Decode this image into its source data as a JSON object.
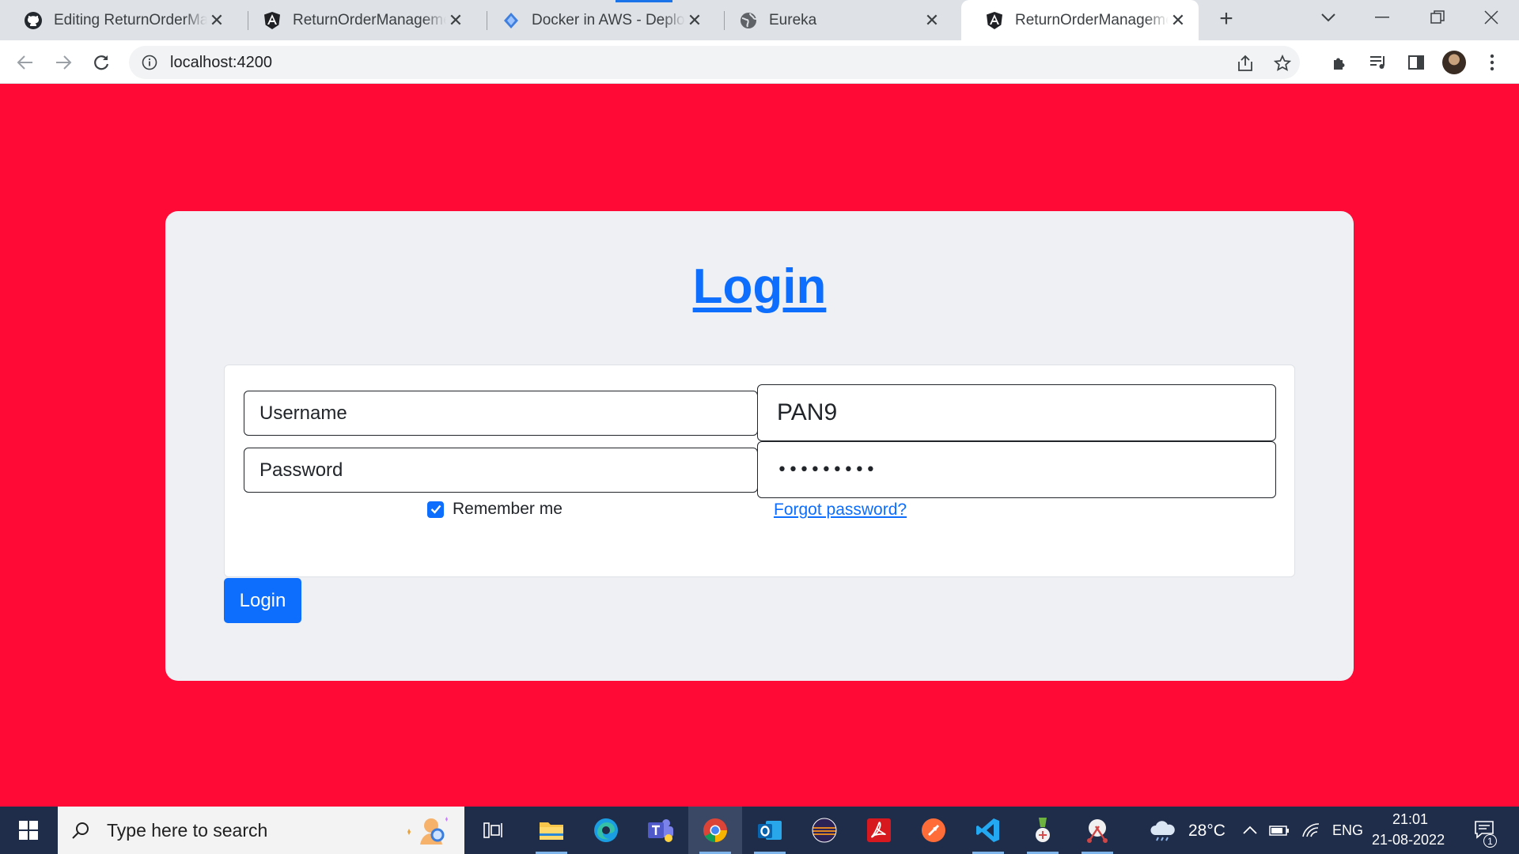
{
  "browser": {
    "tabs": [
      {
        "title": "Editing ReturnOrderManagement",
        "icon": "github-icon",
        "active": false
      },
      {
        "title": "ReturnOrderManagement",
        "icon": "angular-icon",
        "active": false
      },
      {
        "title": "Docker in AWS - Deploy Java",
        "icon": "docker-aws-icon",
        "active": false
      },
      {
        "title": "Eureka",
        "icon": "globe-icon",
        "active": false
      },
      {
        "title": "ReturnOrderManagement",
        "icon": "angular-icon",
        "active": true
      }
    ],
    "url": "localhost:4200"
  },
  "page": {
    "title": "Login",
    "username_label": "Username",
    "username_value": "PAN9",
    "password_label": "Password",
    "password_value": "•••••••••",
    "remember_label": "Remember me",
    "remember_checked": true,
    "forgot_label": "Forgot password?",
    "login_button": "Login",
    "background_color": "#ff0a36",
    "accent_color": "#0d6efd"
  },
  "taskbar": {
    "search_placeholder": "Type here to search",
    "apps": [
      "task-view",
      "file-explorer",
      "edge",
      "teams",
      "chrome",
      "outlook",
      "eclipse",
      "acrobat",
      "postman",
      "vscode",
      "sts",
      "snipping-tool"
    ],
    "weather": "28°C",
    "language": "ENG",
    "time": "21:01",
    "date": "21-08-2022",
    "notification_count": "1"
  }
}
